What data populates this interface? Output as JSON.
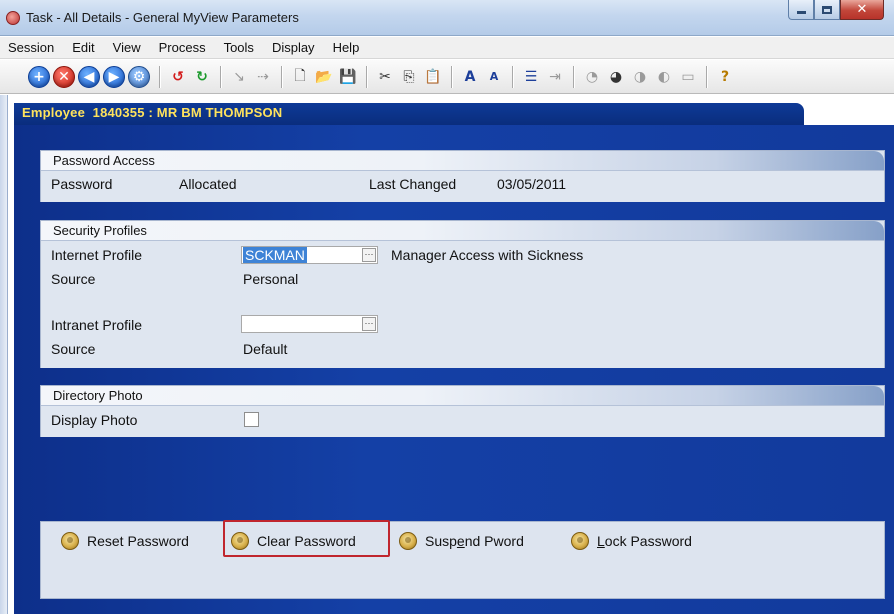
{
  "window": {
    "title": "Task - All Details - General MyView Parameters"
  },
  "menu": [
    "Session",
    "Edit",
    "View",
    "Process",
    "Tools",
    "Display",
    "Help"
  ],
  "toolbar": {
    "icons": [
      "add-icon",
      "cancel-icon",
      "back-icon",
      "forward-icon",
      "settings-icon",
      "undo-icon",
      "redo-icon",
      "pointer-icon",
      "link-icon",
      "new-document-icon",
      "open-folder-icon",
      "save-icon",
      "cut-icon",
      "copy-icon",
      "paste-icon",
      "font-increase-icon",
      "font-decrease-icon",
      "list-icon",
      "indent-icon",
      "tool-a-icon",
      "tool-b-icon",
      "tool-c-icon",
      "tool-d-icon",
      "tool-e-icon",
      "help-icon"
    ]
  },
  "employee": {
    "header": "Employee  1840355 : MR BM THOMPSON"
  },
  "password_access": {
    "heading": "Password Access",
    "password_label": "Password",
    "password_value": "Allocated",
    "last_changed_label": "Last Changed",
    "last_changed_value": "03/05/2011"
  },
  "security_profiles": {
    "heading": "Security Profiles",
    "internet_label": "Internet Profile",
    "internet_value": "SCKMAN",
    "internet_description": "Manager Access with Sickness",
    "source_label_1": "Source",
    "source_value_1": "Personal",
    "intranet_label": "Intranet Profile",
    "intranet_value": "",
    "source_label_2": "Source",
    "source_value_2": "Default"
  },
  "directory_photo": {
    "heading": "Directory Photo",
    "display_label": "Display Photo",
    "display_checked": false
  },
  "actions": {
    "reset": "Reset Password",
    "clear": "Clear Password",
    "suspend_pre": "Susp",
    "suspend_ul": "e",
    "suspend_post": "nd Pword",
    "lock_ul": "L",
    "lock_post": "ock Password"
  },
  "colors": {
    "main_background": "#1440a6",
    "employee_text": "#ffe35c",
    "highlight": "#c0262e",
    "selection": "#3e83d6"
  }
}
